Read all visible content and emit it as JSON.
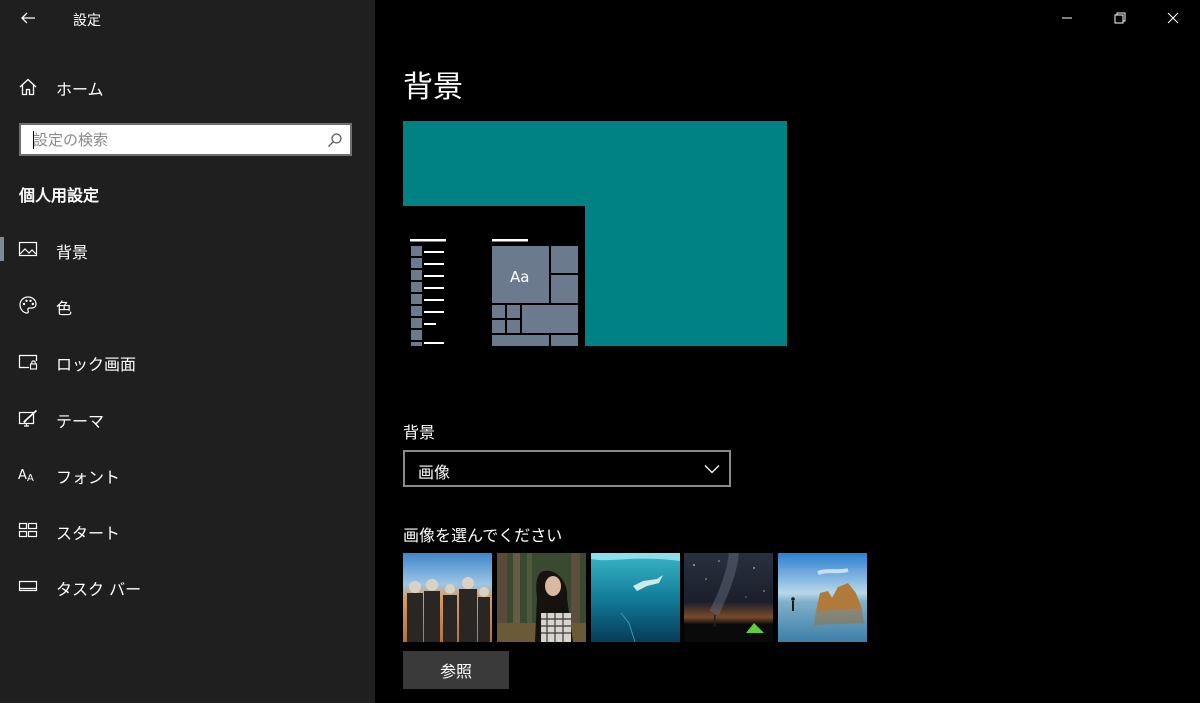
{
  "window": {
    "title": "設定"
  },
  "sidebar": {
    "home_label": "ホーム",
    "search_placeholder": "設定の検索",
    "section_heading": "個人用設定",
    "items": [
      {
        "label": "背景",
        "icon": "picture-icon",
        "selected": true
      },
      {
        "label": "色",
        "icon": "palette-icon",
        "selected": false
      },
      {
        "label": "ロック画面",
        "icon": "lock-screen-icon",
        "selected": false
      },
      {
        "label": "テーマ",
        "icon": "theme-icon",
        "selected": false
      },
      {
        "label": "フォント",
        "icon": "font-icon",
        "selected": false
      },
      {
        "label": "スタート",
        "icon": "start-icon",
        "selected": false
      },
      {
        "label": "タスク バー",
        "icon": "taskbar-icon",
        "selected": false
      }
    ]
  },
  "main": {
    "title": "背景",
    "preview": {
      "tile_text": "Aa",
      "background_color": "#008284",
      "tile_color": "#6c7a8d"
    },
    "background_field_label": "背景",
    "background_value": "画像",
    "choose_label": "画像を選んでください",
    "thumbnails": [
      {
        "icon": "band-photo-thumbnail"
      },
      {
        "icon": "woman-forest-thumbnail"
      },
      {
        "icon": "underwater-swimmer-thumbnail"
      },
      {
        "icon": "night-sky-tent-thumbnail"
      },
      {
        "icon": "beach-rocks-thumbnail"
      }
    ],
    "browse_label": "参照"
  },
  "colors": {
    "accent": "#008284",
    "sidebar_bg": "#1f1f1f",
    "main_bg": "#000000"
  }
}
